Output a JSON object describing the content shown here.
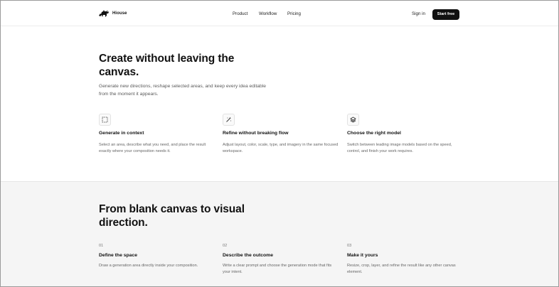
{
  "header": {
    "brand": "Hiouse",
    "nav": [
      "Product",
      "Workflow",
      "Pricing"
    ],
    "signin": "Sign in",
    "cta": "Start free"
  },
  "hero": {
    "title": "Create without leaving the canvas.",
    "description": "Generate new directions, reshape selected areas, and keep every idea editable from the moment it appears.",
    "features": [
      {
        "icon": "selection-square-icon",
        "title": "Generate in context",
        "description": "Select an area, describe what you need, and place the result exactly where your composition needs it."
      },
      {
        "icon": "magic-wand-icon",
        "title": "Refine without breaking flow",
        "description": "Adjust layout, color, scale, type, and imagery in the same focused workspace."
      },
      {
        "icon": "layers-icon",
        "title": "Choose the right model",
        "description": "Switch between leading image models based on the speed, control, and finish your work requires."
      }
    ]
  },
  "process": {
    "title": "From blank canvas to visual direction.",
    "steps": [
      {
        "number": "01",
        "title": "Define the space",
        "description": "Draw a generation area directly inside your composition."
      },
      {
        "number": "02",
        "title": "Describe the outcome",
        "description": "Write a clear prompt and choose the generation mode that fits your intent."
      },
      {
        "number": "03",
        "title": "Make it yours",
        "description": "Resize, crop, layer, and refine the result like any other canvas element."
      }
    ]
  }
}
